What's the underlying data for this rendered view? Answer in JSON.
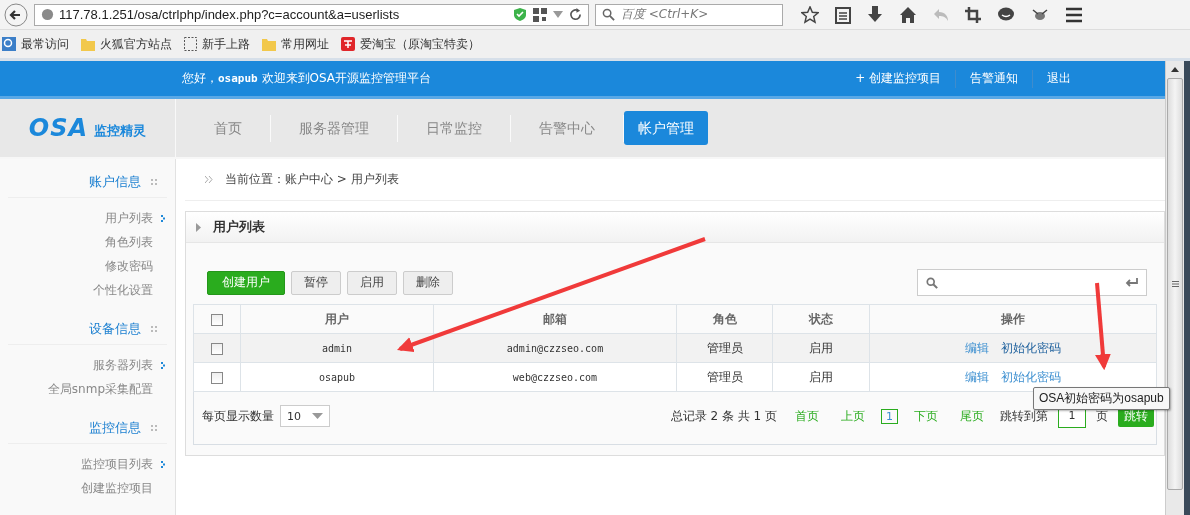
{
  "browser": {
    "url": "117.78.1.251/osa/ctrlphp/index.php?c=account&a=userlists",
    "search_placeholder": "百度 <Ctrl+K>",
    "bookmarks": [
      {
        "label": "最常访问",
        "kind": "globe"
      },
      {
        "label": "火狐官方站点",
        "kind": "folder"
      },
      {
        "label": "新手上路",
        "kind": "page"
      },
      {
        "label": "常用网址",
        "kind": "folder"
      },
      {
        "label": "爱淘宝（原淘宝特卖）",
        "kind": "taobao"
      }
    ]
  },
  "header": {
    "greeting_prefix": "您好，",
    "user": "osapub",
    "greeting_suffix": "欢迎来到OSA开源监控管理平台",
    "links": [
      "+ 创建监控项目",
      "告警通知",
      "退出"
    ]
  },
  "logo": {
    "mark": "OSA",
    "subtitle": "监控精灵"
  },
  "nav": [
    {
      "label": "首页",
      "selected": false
    },
    {
      "label": "服务器管理",
      "selected": false
    },
    {
      "label": "日常监控",
      "selected": false
    },
    {
      "label": "告警中心",
      "selected": false
    },
    {
      "label": "帐户管理",
      "selected": true
    }
  ],
  "sidebar": [
    {
      "title": "账户信息",
      "items": [
        {
          "label": "用户列表",
          "marked": true
        },
        {
          "label": "角色列表",
          "marked": false
        },
        {
          "label": "修改密码",
          "marked": false
        },
        {
          "label": "个性化设置",
          "marked": false
        }
      ]
    },
    {
      "title": "设备信息",
      "items": [
        {
          "label": "服务器列表",
          "marked": true
        },
        {
          "label": "全局snmp采集配置",
          "marked": false
        }
      ]
    },
    {
      "title": "监控信息",
      "items": [
        {
          "label": "监控项目列表",
          "marked": true
        },
        {
          "label": "创建监控项目",
          "marked": false
        }
      ]
    }
  ],
  "breadcrumb": "当前位置：账户中心 > 用户列表",
  "panel_title": "用户列表",
  "toolbar": [
    {
      "label": "创建用户",
      "kind": "primary"
    },
    {
      "label": "暂停",
      "kind": "default"
    },
    {
      "label": "启用",
      "kind": "default"
    },
    {
      "label": "删除",
      "kind": "default"
    }
  ],
  "table": {
    "select_all": {
      "checked": false
    },
    "columns": [
      "用户",
      "邮箱",
      "角色",
      "状态",
      "操作"
    ],
    "rows": [
      {
        "checked": false,
        "user": "admin",
        "email": "admin@czzseo.com",
        "role": "管理员",
        "status": "启用",
        "actions": [
          "编辑",
          "初始化密码"
        ]
      },
      {
        "checked": false,
        "user": "osapub",
        "email": "web@czzseo.com",
        "role": "管理员",
        "status": "启用",
        "actions": [
          "编辑",
          "初始化密码"
        ]
      }
    ]
  },
  "pagination": {
    "page_size_label": "每页显示数量",
    "page_size": "10",
    "summary": "总记录 2 条  共 1 页",
    "links": [
      "首页",
      "上页"
    ],
    "current": "1",
    "links_after": [
      "下页",
      "尾页"
    ],
    "jump_label": "跳转到第",
    "jump_value": "1",
    "page_unit": "页",
    "jump_button": "跳转"
  },
  "tooltip": "OSA初始密码为osapub"
}
